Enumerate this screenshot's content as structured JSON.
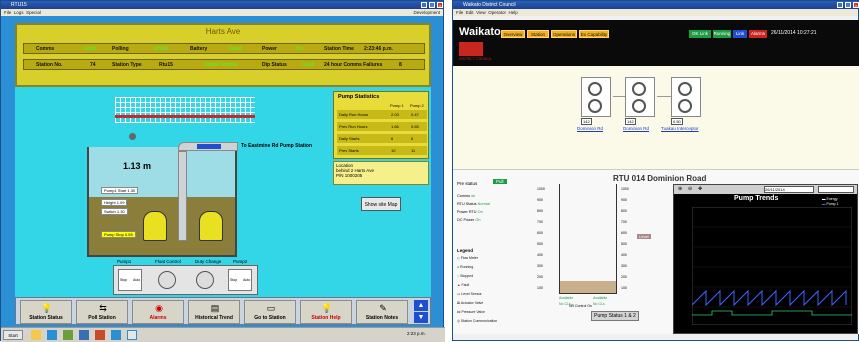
{
  "left": {
    "window_title": "RTU15",
    "menu": [
      "File",
      "Logs",
      "Special"
    ],
    "menu_right": "Development",
    "station": {
      "name": "Harts Ave",
      "row1": {
        "comms_label": "Comms",
        "comms_value": "Good",
        "polling_label": "Polling",
        "polling_value": "Online",
        "battery_label": "Battery",
        "battery_value": "Good",
        "power_label": "Power",
        "power_value": "On",
        "station_time_label": "Station Time",
        "station_time_value": "2:23:46 p.m."
      },
      "row2": {
        "station_no_label": "Station No.",
        "station_no_value": "74",
        "station_type_label": "Station Type",
        "station_type_value": "Rtu15",
        "station_status_value": "Station Normal",
        "dip_status_label": "Dip Status",
        "dip_status_value": "Good",
        "comms_failures_label": "24 hour Comms Failures",
        "comms_failures_value": "8"
      }
    },
    "scene": {
      "level": "1.13 m",
      "pipe_label": "To Eastmine Rd Pump Station",
      "gauges": [
        {
          "label": "Pump1 Start",
          "value": "1.30"
        },
        {
          "label": "Height",
          "value": "1.09"
        },
        {
          "label": "Switch",
          "value": "1.30"
        },
        {
          "label": "Pump Stop",
          "value": "0.59"
        }
      ],
      "control_labels": [
        "Pump1",
        "Float Control",
        "Duty Change",
        "Pump2"
      ],
      "switch_labels": [
        "Stop",
        "Auto"
      ]
    },
    "pump_stats": {
      "title": "Pump Statistics",
      "col1": "Pump 1",
      "col2": "Pump 2",
      "rows": [
        {
          "label": "Daily Run Hours",
          "p1": "2.03",
          "p2": "0.47"
        },
        {
          "label": "Prev Run Hours",
          "p1": "1.66",
          "p2": "0.65"
        },
        {
          "label": "Daily Starts",
          "p1": "6",
          "p2": "6"
        },
        {
          "label": "Prev Starts",
          "p1": "10",
          "p2": "11"
        }
      ]
    },
    "location": {
      "label": "Location",
      "line1": "behind 2 Harts Ave",
      "line2": "P/N 1000205"
    },
    "site_map_button": "Show site Map",
    "toolbar": [
      "Station Status",
      "Poll Station",
      "Alarms",
      "Historical Trend",
      "Go to Station",
      "Station Help",
      "Station Notes"
    ],
    "taskbar": {
      "start": "Start",
      "time": "2:23 p.m."
    }
  },
  "right": {
    "window_title": "Waikato District Council",
    "menu": [
      "File",
      "Edit",
      "View",
      "Operator",
      "Help"
    ],
    "header": {
      "brand": "Waikato",
      "brand_sub": "DISTRICT COUNCIL",
      "nav": [
        "Overview",
        "Station",
        "Operations",
        "Ex Capability"
      ],
      "status": [
        "OK Link",
        "Running",
        "Link",
        "Alarms"
      ],
      "datetime": "26/11/2014 10:27:21"
    },
    "pumps": [
      {
        "label": "Stage 1",
        "link": "Dominion Rd",
        "value": "142"
      },
      {
        "label": "Stage 2",
        "link": "Dominion Rd",
        "value": "142"
      },
      {
        "label": "Stage 3",
        "link": "Tuakau Interceptor",
        "value": "0.50"
      }
    ],
    "rtu": {
      "title": "RTU 014 Dominion Road",
      "pre_status_label": "Pre status",
      "pre_status_value": "Pull",
      "info": [
        {
          "label": "Comms",
          "value": "ok"
        },
        {
          "label": "RTU Status",
          "value": "Normal"
        },
        {
          "label": "Power RTU",
          "value": "On"
        },
        {
          "label": "DC Power",
          "value": "On"
        }
      ],
      "y_ticks_left": [
        "1000",
        "900",
        "800",
        "700",
        "600",
        "500",
        "400",
        "300",
        "200",
        "100"
      ],
      "y_ticks_right": [
        "1000",
        "900",
        "800",
        "700",
        "600",
        "500",
        "400",
        "300",
        "200",
        "100"
      ],
      "level_label": "Level",
      "available": [
        "Available",
        "Available"
      ],
      "sub": [
        "No CLs",
        "No CLs"
      ],
      "control": "NR Control On",
      "pump_status_button": "Pump Status 1 & 2",
      "legend_title": "Legend",
      "legend": [
        "Flow Meter",
        "Running",
        "Stopped",
        "Fault",
        "Level Sensor",
        "Actuator Valve",
        "Pressure Valve",
        "Station Communication"
      ]
    },
    "trends": {
      "title": "Pump Trends",
      "date_field": "26/11/2014",
      "legend": [
        "Energy",
        "Pump 1",
        "Pump 2"
      ]
    }
  }
}
